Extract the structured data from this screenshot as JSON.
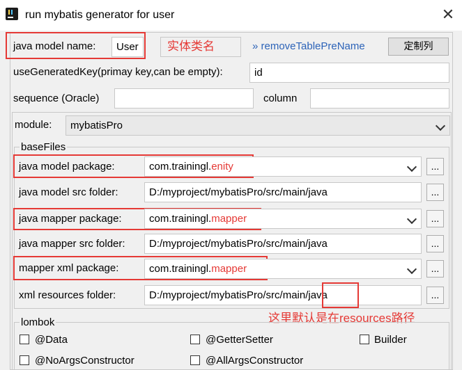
{
  "window": {
    "title": "run mybatis generator for user",
    "close_glyph": "✕"
  },
  "model": {
    "java_model_name_label": "java model name:",
    "java_model_name_value": "User",
    "annotation_entity_name": "实体类名",
    "remove_prefix_link": "» removeTablePreName",
    "custom_columns_button": "定制列"
  },
  "use_generated_key": {
    "label": "useGeneratedKey(primay key,can be empty):",
    "value": "id"
  },
  "sequence": {
    "label": "sequence (Oracle)",
    "value": "",
    "column_label": "column",
    "column_value": ""
  },
  "module": {
    "label": "module:",
    "value": "mybatisPro"
  },
  "basefiles": {
    "title": "baseFiles",
    "rows": [
      {
        "label": "java model package:",
        "value_prefix": "com.trainingl.",
        "value_suffix": "enity",
        "type": "combo"
      },
      {
        "label": "java model src folder:",
        "value_prefix": "D:/myproject/mybatisPro/src/main/java",
        "value_suffix": "",
        "type": "text"
      },
      {
        "label": "java mapper package:",
        "value_prefix": "com.trainingl.",
        "value_suffix": "mapper",
        "type": "combo"
      },
      {
        "label": "java mapper src folder:",
        "value_prefix": "D:/myproject/mybatisPro/src/main/java",
        "value_suffix": "",
        "type": "text"
      },
      {
        "label": "mapper xml package:",
        "value_prefix": "com.trainingl.",
        "value_suffix": "mapper",
        "type": "combo"
      },
      {
        "label": "xml resources folder:",
        "value_prefix": "D:/myproject/mybatisPro/src/main",
        "value_suffix": "/java",
        "type": "text"
      }
    ],
    "browse_label": "...",
    "annotation_resources": "这里默认是在resources路径"
  },
  "lombok": {
    "title": "lombok",
    "options": [
      "@Data",
      "@GetterSetter",
      "Builder",
      "@NoArgsConstructor",
      "@AllArgsConstructor"
    ],
    "checked": [
      false,
      false,
      false,
      false,
      false
    ]
  }
}
